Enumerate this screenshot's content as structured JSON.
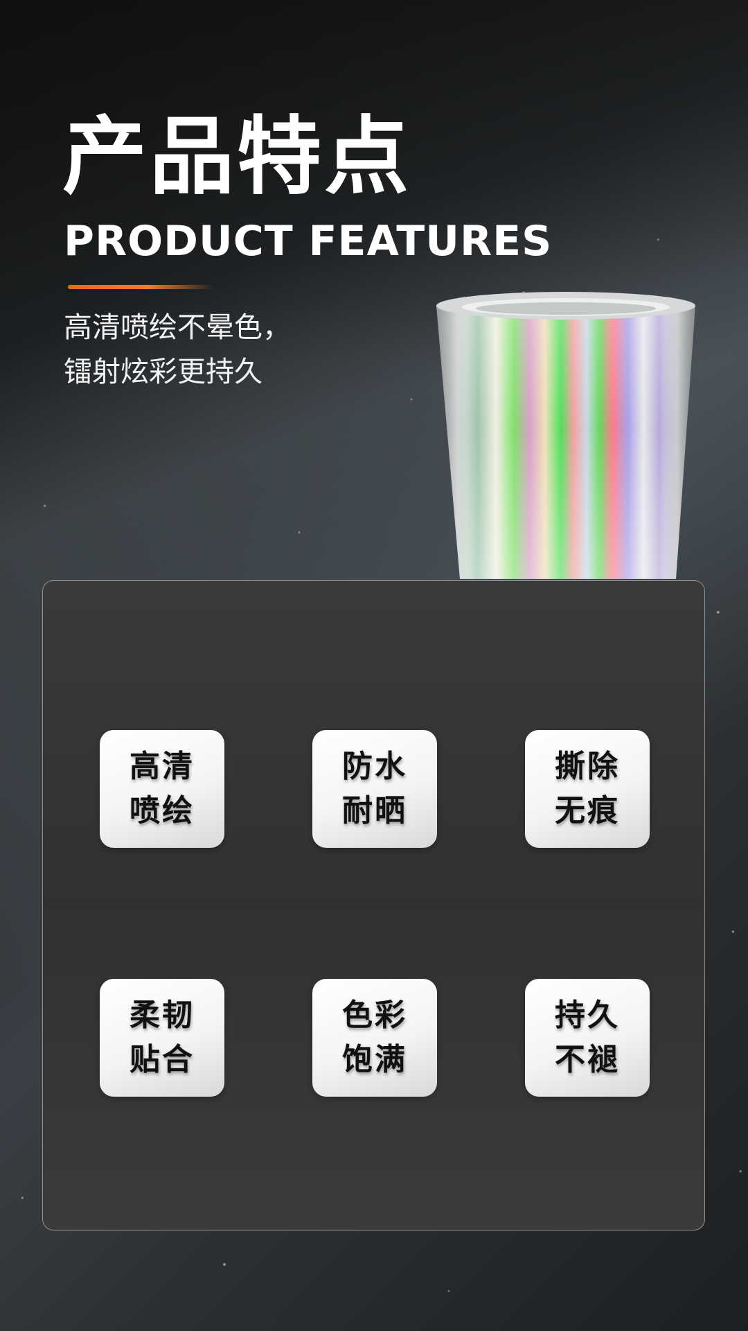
{
  "header": {
    "title_cn": "产品特点",
    "title_en": "PRODUCT FEATURES",
    "accent_color": "#ee7a2a",
    "subtitle_lines": [
      "高清喷绘不晕色，",
      "镭射炫彩更持久"
    ]
  },
  "features": [
    {
      "line1": "高清",
      "line2": "喷绘"
    },
    {
      "line1": "防水",
      "line2": "耐晒"
    },
    {
      "line1": "撕除",
      "line2": "无痕"
    },
    {
      "line1": "柔韧",
      "line2": "贴合"
    },
    {
      "line1": "色彩",
      "line2": "饱满"
    },
    {
      "line1": "持久",
      "line2": "不褪"
    }
  ]
}
